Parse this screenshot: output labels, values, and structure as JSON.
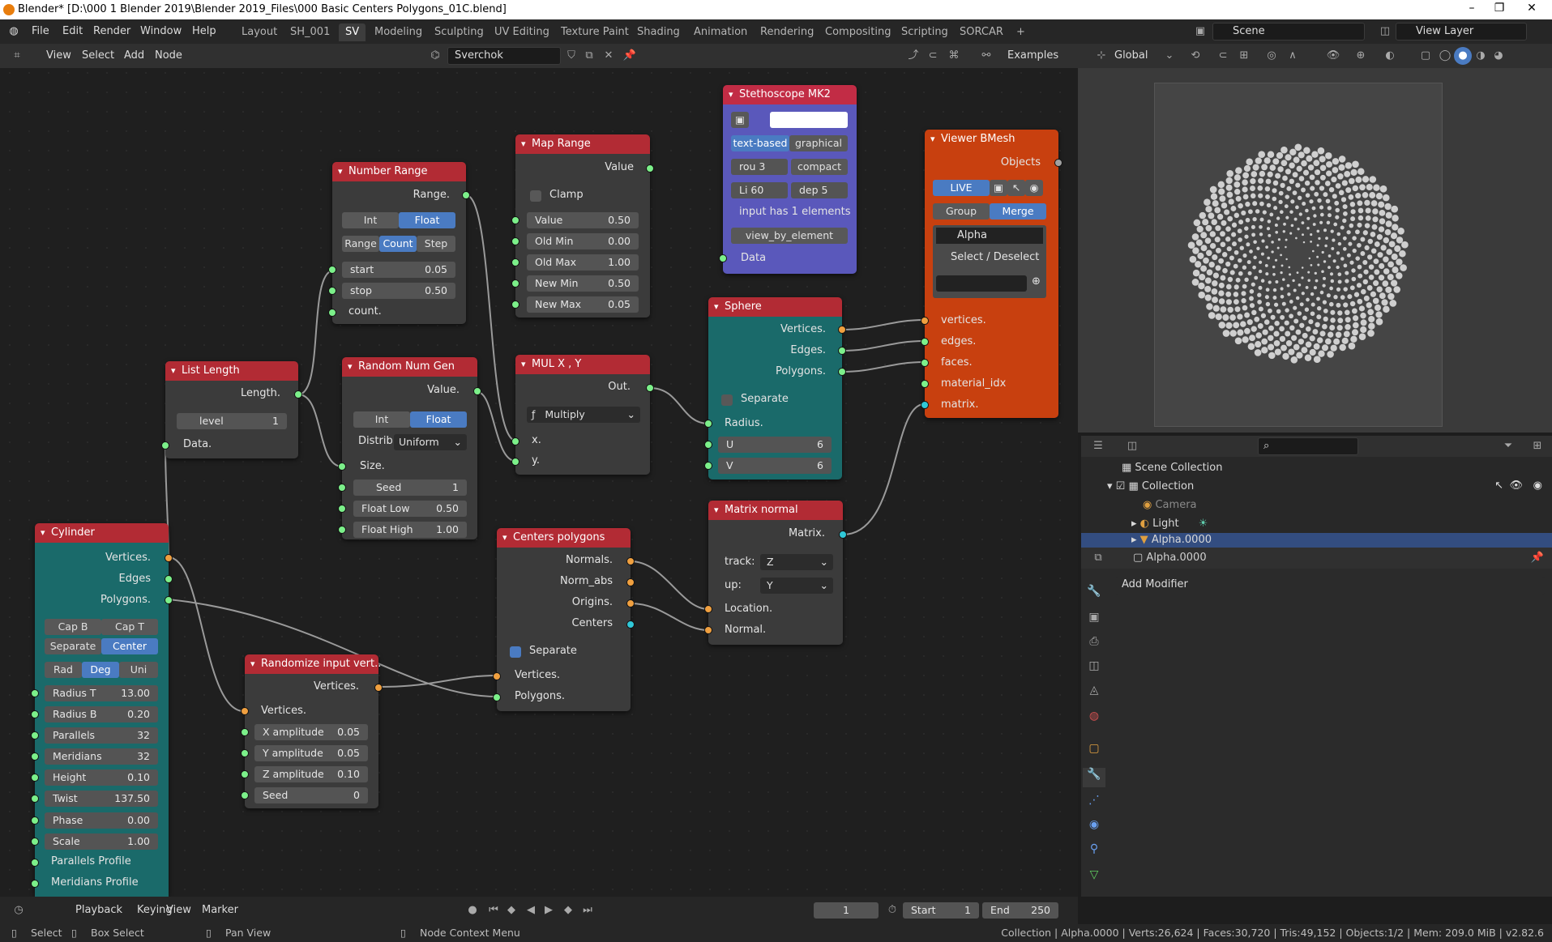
{
  "window": {
    "title": "Blender* [D:\\000 1 Blender 2019\\Blender 2019_Files\\000 Basic Centers Polygons_01C.blend]",
    "minimize": "–",
    "maximize": "❐",
    "close": "✕"
  },
  "menu": [
    "File",
    "Edit",
    "Render",
    "Window",
    "Help"
  ],
  "workspaces": [
    "Layout",
    "SH_001",
    "SV",
    "Modeling",
    "Sculpting",
    "UV Editing",
    "Texture Paint",
    "Shading",
    "Animation",
    "Rendering",
    "Compositing",
    "Scripting",
    "SORCAR",
    "+"
  ],
  "scene": {
    "label": "Scene",
    "view_layer": "View Layer"
  },
  "node_editor": {
    "menu": [
      "View",
      "Select",
      "Add",
      "Node"
    ],
    "tree_name": "Sverchok",
    "examples": "Examples"
  },
  "viewport": {
    "orientation": "Global"
  },
  "nodes": {
    "stethoscope": {
      "title": "Stethoscope MK2",
      "text_based": "text-based",
      "graphical": "graphical",
      "rou": "rou",
      "rou_v": "3",
      "compact": "compact",
      "li": "Li",
      "li_v": "60",
      "dep": "dep",
      "dep_v": "5",
      "info": "input has 1 elements",
      "view": "view_by_element",
      "data": "Data"
    },
    "map_range": {
      "title": "Map Range",
      "value_out": "Value",
      "clamp": "Clamp",
      "rows": [
        {
          "l": "Value",
          "v": "0.50"
        },
        {
          "l": "Old Min",
          "v": "0.00"
        },
        {
          "l": "Old Max",
          "v": "1.00"
        },
        {
          "l": "New Min",
          "v": "0.50"
        },
        {
          "l": "New Max",
          "v": "0.05"
        }
      ]
    },
    "number_range": {
      "title": "Number Range",
      "range_out": "Range.",
      "int": "Int",
      "float": "Float",
      "range": "Range",
      "count": "Count",
      "step": "Step",
      "start": "start",
      "start_v": "0.05",
      "stop": "stop",
      "stop_v": "0.50",
      "count_in": "count."
    },
    "viewer": {
      "title": "Viewer BMesh",
      "objects": "Objects",
      "live": "LIVE",
      "group": "Group",
      "merge": "Merge",
      "name": "Alpha",
      "select": "Select / Deselect",
      "inputs": [
        "vertices.",
        "edges.",
        "faces.",
        "material_idx",
        "matrix."
      ]
    },
    "sphere": {
      "title": "Sphere",
      "outs": [
        "Vertices.",
        "Edges.",
        "Polygons."
      ],
      "separate": "Separate",
      "radius": "Radius.",
      "u": "U",
      "u_v": "6",
      "v": "V",
      "v_v": "6"
    },
    "list_length": {
      "title": "List Length",
      "length": "Length.",
      "level": "level",
      "level_v": "1",
      "data": "Data."
    },
    "random": {
      "title": "Random Num Gen",
      "value": "Value.",
      "int": "Int",
      "float": "Float",
      "distrib": "Distrib",
      "uniform": "Uniform",
      "size": "Size.",
      "rows": [
        {
          "l": "Seed",
          "v": "1"
        },
        {
          "l": "Float Low",
          "v": "0.50"
        },
        {
          "l": "Float High",
          "v": "1.00"
        }
      ]
    },
    "mul": {
      "title": "MUL X , Y",
      "out": "Out.",
      "op": "Multiply",
      "x": "x.",
      "y": "y."
    },
    "matrix_normal": {
      "title": "Matrix normal",
      "matrix": "Matrix.",
      "track": "track:",
      "track_v": "Z",
      "up": "up:",
      "up_v": "Y",
      "location": "Location.",
      "normal": "Normal."
    },
    "centers": {
      "title": "Centers polygons",
      "outs": [
        "Normals.",
        "Norm_abs",
        "Origins.",
        "Centers"
      ],
      "separate": "Separate",
      "vertices": "Vertices.",
      "polygons": "Polygons."
    },
    "cylinder": {
      "title": "Cylinder",
      "outs": [
        "Vertices.",
        "Edges",
        "Polygons."
      ],
      "capb": "Cap B",
      "capt": "Cap T",
      "separate": "Separate",
      "center": "Center",
      "rad": "Rad",
      "deg": "Deg",
      "uni": "Uni",
      "rows": [
        {
          "l": "Radius T",
          "v": "13.00"
        },
        {
          "l": "Radius B",
          "v": "0.20"
        },
        {
          "l": "Parallels",
          "v": "32"
        },
        {
          "l": "Meridians",
          "v": "32"
        },
        {
          "l": "Height",
          "v": "0.10"
        },
        {
          "l": "Twist",
          "v": "137.50"
        },
        {
          "l": "Phase",
          "v": "0.00"
        },
        {
          "l": "Scale",
          "v": "1.00"
        }
      ],
      "pprof": "Parallels Profile",
      "mprof": "Meridians Profile"
    },
    "randomize": {
      "title": "Randomize input vert..",
      "vout": "Vertices.",
      "vin": "Vertices.",
      "rows": [
        {
          "l": "X amplitude",
          "v": "0.05"
        },
        {
          "l": "Y amplitude",
          "v": "0.05"
        },
        {
          "l": "Z amplitude",
          "v": "0.10"
        },
        {
          "l": "Seed",
          "v": "0"
        }
      ]
    }
  },
  "outliner": {
    "root": "Scene Collection",
    "collection": "Collection",
    "camera": "Camera",
    "light": "Light",
    "alpha": "Alpha.0000"
  },
  "properties": {
    "object": "Alpha.0000",
    "add_modifier": "Add Modifier"
  },
  "timeline": {
    "playback": "Playback",
    "keying": "Keying",
    "view": "View",
    "marker": "Marker",
    "frame": "1",
    "start_l": "Start",
    "start": "1",
    "end_l": "End",
    "end": "250"
  },
  "status": {
    "select": "Select",
    "box": "Box Select",
    "pan": "Pan View",
    "ctx": "Node Context Menu",
    "stats": "Collection | Alpha.0000 | Verts:26,624 | Faces:30,720 | Tris:49,152 | Objects:1/2 | Mem: 209.0 MiB | v2.82.6"
  }
}
